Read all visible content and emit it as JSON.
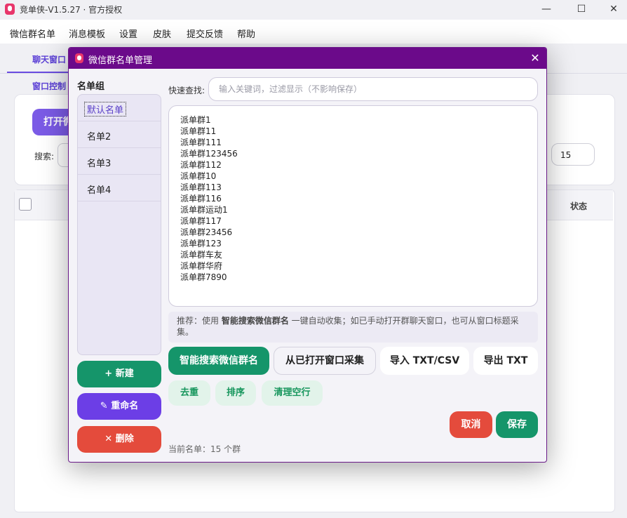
{
  "app": {
    "title": "竞单侠-V1.5.27 · 官方授权",
    "window_controls": {
      "minimize": "—",
      "maximize": "☐",
      "close": "✕"
    }
  },
  "menu": [
    "微信群名单",
    "消息模板",
    "设置",
    "皮肤",
    "提交反馈",
    "帮助"
  ],
  "main": {
    "tab_active": "聊天窗口",
    "subtab": "窗口控制",
    "open_button": "打开微",
    "search_label": "搜索:",
    "count_value": "15",
    "table_header_status": "状态"
  },
  "dialog": {
    "title": "微信群名单管理",
    "close": "✕",
    "group_label": "名单组",
    "groups": [
      "默认名单",
      "名单2",
      "名单3",
      "名单4"
    ],
    "selected_group_index": 0,
    "quick_find_label": "快速查找:",
    "quick_find_placeholder": "输入关键词，过滤显示（不影响保存）",
    "list_items": [
      "派单群1",
      "派单群11",
      "派单群111",
      "派单群123456",
      "派单群112",
      "派单群10",
      "派单群113",
      "派单群116",
      "派单群运动1",
      "派单群117",
      "派单群23456",
      "派单群123",
      "派单群车友",
      "派单群华府",
      "派单群7890"
    ],
    "hint_prefix": "推荐：使用 ",
    "hint_bold": "智能搜索微信群名",
    "hint_suffix": " 一键自动收集；如已手动打开群聊天窗口，也可从窗口标题采集。",
    "buttons": {
      "new": "+ 新建",
      "rename": "✎ 重命名",
      "delete": "✕ 删除",
      "smart_search": "智能搜索微信群名",
      "collect_open": "从已打开窗口采集",
      "import": "导入 TXT/CSV",
      "export": "导出 TXT",
      "dedupe": "去重",
      "sort": "排序",
      "clean_empty": "清理空行",
      "cancel": "取消",
      "save": "保存"
    },
    "current_count": "当前名单：15 个群"
  },
  "colors": {
    "dialog_titlebar": "#6b0a8a",
    "primary_green": "#15956a",
    "purple": "#6c3ee6",
    "red": "#e44b3c"
  }
}
